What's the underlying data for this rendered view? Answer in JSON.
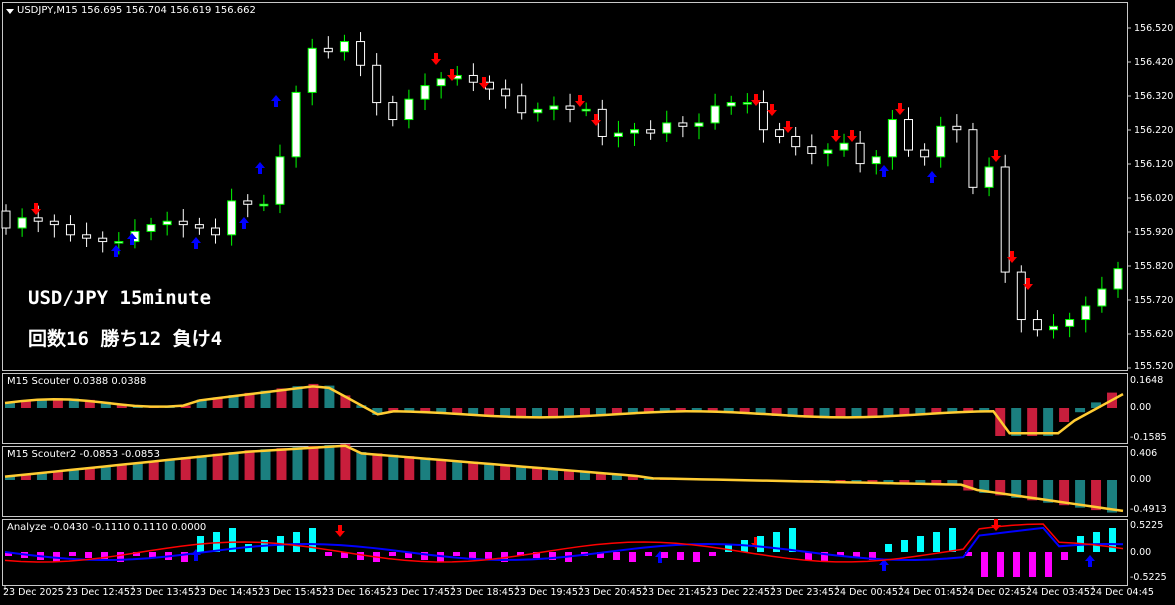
{
  "main": {
    "header": "USDJPY,M15  156.695 156.704 156.619 156.662",
    "overlay_line1": "USD/JPY 15minute",
    "overlay_line2": "回数16 勝ち12 負け4",
    "price_ticks": [
      "156.520",
      "156.420",
      "156.320",
      "156.220",
      "156.120",
      "156.020",
      "155.920",
      "155.820",
      "155.720",
      "155.620",
      "155.520"
    ]
  },
  "scouter": {
    "header": "M15 Scouter 0.0388 0.0388",
    "ticks": [
      "0.1648",
      "0.00",
      "-0.1585"
    ]
  },
  "scouter2": {
    "header": "M15 Scouter2 -0.0853 -0.0853",
    "ticks": [
      "0.406",
      "0.00",
      "-0.4913"
    ]
  },
  "analyze": {
    "header": "Analyze -0.0430 -0.1110 0.1110 0.0000",
    "ticks": [
      "0.5225",
      "0.00",
      "-0.5225"
    ]
  },
  "time_axis": [
    "23 Dec 2025",
    "23 Dec 12:45",
    "23 Dec 13:45",
    "23 Dec 14:45",
    "23 Dec 15:45",
    "23 Dec 16:45",
    "23 Dec 17:45",
    "23 Dec 18:45",
    "23 Dec 19:45",
    "23 Dec 20:45",
    "23 Dec 21:45",
    "23 Dec 22:45",
    "23 Dec 23:45",
    "24 Dec 00:45",
    "24 Dec 01:45",
    "24 Dec 02:45",
    "24 Dec 03:45",
    "24 Dec 04:45"
  ],
  "colors": {
    "bull_body": "#ffffff",
    "bear_body": "#000000",
    "wick_up": "#00ff00",
    "wick_down": "#ffffff",
    "sell_arrow": "#ff0000",
    "buy_arrow": "#0000ff",
    "hist_pos": "#1b7f7f",
    "hist_neg": "#c81e3c",
    "signal_line": "#ffcc33",
    "analyze_pos": "#00ffff",
    "analyze_neg": "#ff00ff",
    "analyze_line_a": "#0000ff",
    "analyze_line_b": "#ff0000"
  }
}
